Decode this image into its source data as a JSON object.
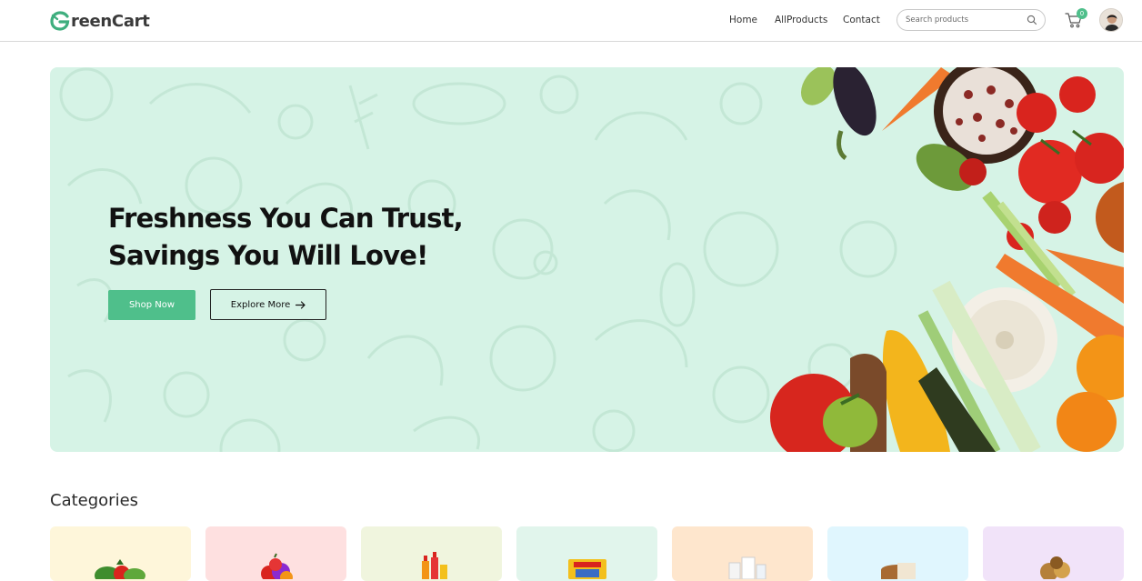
{
  "brand": {
    "name": "reenCart",
    "accent": "#4fbf8b"
  },
  "nav": {
    "links": [
      "Home",
      "AllProducts",
      "Contact"
    ],
    "search_placeholder": "Search products",
    "cart_count": "0"
  },
  "hero": {
    "title_line1": "Freshness You Can Trust,",
    "title_line2": "Savings You Will Love!",
    "shop_label": "Shop Now",
    "explore_label": "Explore More",
    "background": "#d6f3e6"
  },
  "categories": {
    "title": "Categories",
    "cards": [
      {
        "icon": "vegetables-image",
        "bg": "#fef6da"
      },
      {
        "icon": "fruits-image",
        "bg": "#fee0e0"
      },
      {
        "icon": "drinks-image",
        "bg": "#f0f5de"
      },
      {
        "icon": "instant-food-image",
        "bg": "#e1f5ec"
      },
      {
        "icon": "dairy-image",
        "bg": "#fee6cd"
      },
      {
        "icon": "bakery-image",
        "bg": "#e0f6fe"
      },
      {
        "icon": "grains-image",
        "bg": "#f1e3f9"
      }
    ]
  }
}
